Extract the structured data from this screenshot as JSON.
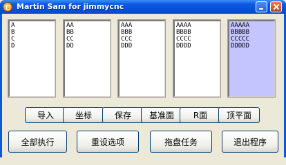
{
  "window": {
    "title": "Martin Sam for jimmycnc"
  },
  "lists": [
    [
      "A",
      "B",
      "C",
      "D"
    ],
    [
      "AA",
      "BB",
      "CC",
      "DD"
    ],
    [
      "AAA",
      "BBB",
      "CCC",
      "DDD"
    ],
    [
      "AAAA",
      "BBBB",
      "CCCC",
      "DDDD"
    ],
    [
      "AAAAA",
      "BBBBB",
      "CCCCC",
      "DDDDD"
    ]
  ],
  "buttons_row1": [
    "导入",
    "坐标",
    "保存",
    "基准面",
    "R面",
    "顶平面"
  ],
  "buttons_row2": [
    "全部执行",
    "重设选项",
    "拖盘任务",
    "退出程序"
  ],
  "colors": {
    "titlebar": "#0550d8",
    "selected_list": "#c4c4ff",
    "face": "#ece9d8"
  }
}
